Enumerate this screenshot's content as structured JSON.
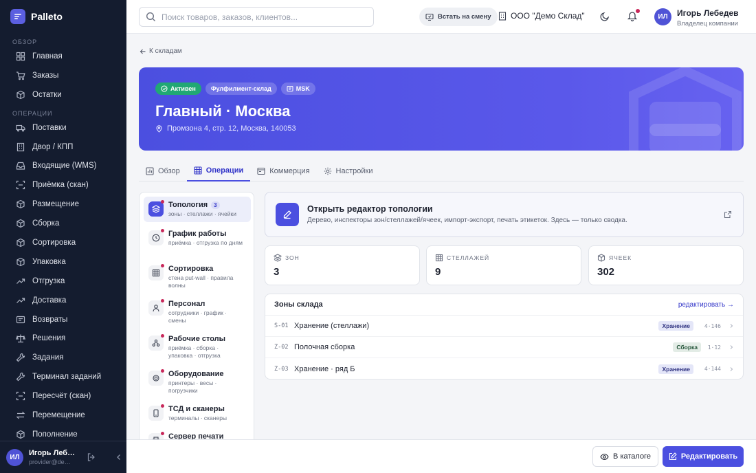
{
  "app": {
    "name": "Palleto"
  },
  "sidebar": {
    "groups": [
      {
        "label": "ОБЗОР",
        "items": [
          {
            "label": "Главная",
            "icon": "grid-icon"
          },
          {
            "label": "Заказы",
            "icon": "cart-icon"
          },
          {
            "label": "Остатки",
            "icon": "box-icon"
          }
        ]
      },
      {
        "label": "ОПЕРАЦИИ",
        "items": [
          {
            "label": "Поставки",
            "icon": "truck-icon"
          },
          {
            "label": "Двор / КПП",
            "icon": "building-icon"
          },
          {
            "label": "Входящие (WMS)",
            "icon": "inbox-icon"
          },
          {
            "label": "Приёмка (скан)",
            "icon": "scan-icon"
          },
          {
            "label": "Размещение",
            "icon": "box-icon"
          },
          {
            "label": "Сборка",
            "icon": "box-icon"
          },
          {
            "label": "Сортировка",
            "icon": "box-icon"
          },
          {
            "label": "Упаковка",
            "icon": "box-icon"
          },
          {
            "label": "Отгрузка",
            "icon": "trend-icon"
          },
          {
            "label": "Доставка",
            "icon": "trend-icon"
          },
          {
            "label": "Возвраты",
            "icon": "return-icon"
          },
          {
            "label": "Решения",
            "icon": "scale-icon"
          },
          {
            "label": "Задания",
            "icon": "wrench-icon"
          },
          {
            "label": "Терминал заданий",
            "icon": "wrench-icon"
          },
          {
            "label": "Пересчёт (скан)",
            "icon": "scan-icon"
          },
          {
            "label": "Перемещение",
            "icon": "swap-icon"
          },
          {
            "label": "Пополнение",
            "icon": "box-icon"
          }
        ]
      }
    ],
    "user": {
      "initials": "ИЛ",
      "name": "Игорь Лебедев",
      "email": "provider@demo.ru"
    }
  },
  "topbar": {
    "search_placeholder": "Поиск товаров, заказов, клиентов...",
    "shift_label": "Встать на смену",
    "org_name": "ООО \"Демо Склад\"",
    "user": {
      "initials": "ИЛ",
      "name": "Игорь Лебедев",
      "role": "Владелец компании"
    }
  },
  "page": {
    "back_label": "К складам",
    "hero": {
      "chips": [
        "Активен",
        "Фулфилмент-склад",
        "MSK"
      ],
      "title": "Главный · Москва",
      "address": "Промзона 4, стр. 12, Москва, 140053"
    },
    "tabs": [
      {
        "label": "Обзор",
        "icon": "chart-icon"
      },
      {
        "label": "Операции",
        "icon": "table-icon"
      },
      {
        "label": "Коммерция",
        "icon": "receipt-icon"
      },
      {
        "label": "Настройки",
        "icon": "gear-icon"
      }
    ],
    "active_tab": 1,
    "menu": [
      {
        "title": "Топология",
        "badge": "3",
        "sub": "зоны · стеллажи · ячейки",
        "icon": "layers-icon"
      },
      {
        "title": "График работы",
        "sub": "приёмка · отгрузка по дням",
        "icon": "clock-icon"
      },
      {
        "title": "Сортировка",
        "sub": "стена put-wall · правила волны",
        "icon": "grid-icon"
      },
      {
        "title": "Персонал",
        "sub": "сотрудники · график · смены",
        "icon": "person-icon"
      },
      {
        "title": "Рабочие столы",
        "sub": "приёмка · сборка · упаковка · отгрузка",
        "icon": "workflow-icon"
      },
      {
        "title": "Оборудование",
        "sub": "принтеры · весы · погрузчики",
        "icon": "gear-icon"
      },
      {
        "title": "ТСД и сканеры",
        "sub": "терминалы · сканеры",
        "icon": "device-icon"
      },
      {
        "title": "Сервер печати",
        "sub": "",
        "icon": "printer-icon"
      }
    ],
    "editor": {
      "title": "Открыть редактор топологии",
      "desc": "Дерево, инспекторы зон/стеллажей/ячеек, импорт-экспорт, печать этикеток. Здесь — только сводка."
    },
    "stats": [
      {
        "label": "ЗОН",
        "value": "3",
        "icon": "layers-icon"
      },
      {
        "label": "СТЕЛЛАЖЕЙ",
        "value": "9",
        "icon": "grid-icon"
      },
      {
        "label": "ЯЧЕЕК",
        "value": "302",
        "icon": "box-icon"
      }
    ],
    "zones": {
      "title": "Зоны склада",
      "edit_label": "редактировать →",
      "rows": [
        {
          "code": "S-01",
          "name": "Хранение (стеллажи)",
          "tag": "Хранение",
          "count": "4·146"
        },
        {
          "code": "Z-02",
          "name": "Полочная сборка",
          "tag": "Сборка",
          "count": "1·12"
        },
        {
          "code": "Z-03",
          "name": "Хранение · ряд Б",
          "tag": "Хранение",
          "count": "4·144"
        }
      ]
    },
    "actions": {
      "catalog_label": "В каталоге",
      "edit_label": "Редактировать"
    }
  },
  "colors": {
    "accent": "#4b4fe0",
    "sidebar": "#141c2f",
    "success": "#21a874",
    "notify": "#c8285a"
  }
}
